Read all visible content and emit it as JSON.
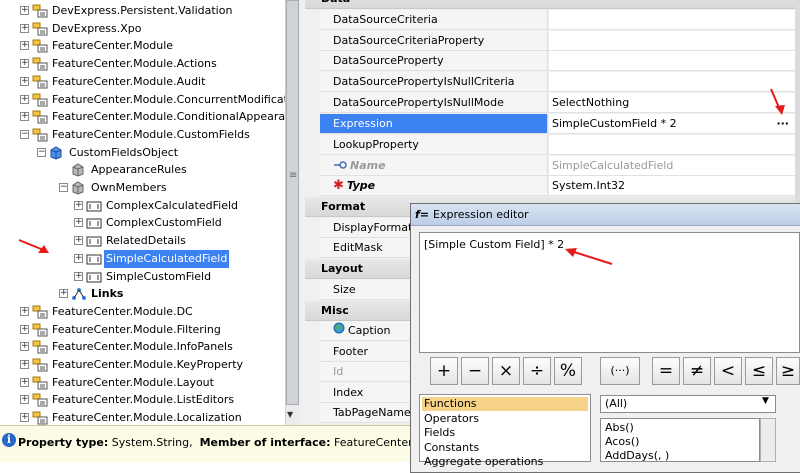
{
  "tree": {
    "items": [
      {
        "label": "DevExpress.Persistent.Validation",
        "level": 0,
        "icon": "namespace-icon",
        "expander": "+"
      },
      {
        "label": "DevExpress.Xpo",
        "level": 0,
        "icon": "namespace-icon",
        "expander": "+"
      },
      {
        "label": "FeatureCenter.Module",
        "level": 0,
        "icon": "namespace-icon",
        "expander": "+"
      },
      {
        "label": "FeatureCenter.Module.Actions",
        "level": 0,
        "icon": "namespace-icon",
        "expander": "+"
      },
      {
        "label": "FeatureCenter.Module.Audit",
        "level": 0,
        "icon": "namespace-icon",
        "expander": "+"
      },
      {
        "label": "FeatureCenter.Module.ConcurrentModifications",
        "level": 0,
        "icon": "namespace-icon",
        "expander": "+"
      },
      {
        "label": "FeatureCenter.Module.ConditionalAppearance",
        "level": 0,
        "icon": "namespace-icon",
        "expander": "+"
      },
      {
        "label": "FeatureCenter.Module.CustomFields",
        "level": 0,
        "icon": "namespace-icon",
        "expander": "-"
      },
      {
        "label": "CustomFieldsObject",
        "level": 1,
        "icon": "class-cube-icon",
        "expander": "-"
      },
      {
        "label": "AppearanceRules",
        "level": 2,
        "icon": "gray-cube-icon",
        "expander": ""
      },
      {
        "label": "OwnMembers",
        "level": 2,
        "icon": "gray-cube-icon",
        "expander": "-"
      },
      {
        "label": "ComplexCalculatedField",
        "level": 3,
        "icon": "member-field-icon",
        "expander": "+"
      },
      {
        "label": "ComplexCustomField",
        "level": 3,
        "icon": "member-field-icon",
        "expander": "+"
      },
      {
        "label": "RelatedDetails",
        "level": 3,
        "icon": "member-field-icon",
        "expander": "+"
      },
      {
        "label": "SimpleCalculatedField",
        "level": 3,
        "icon": "member-field-icon",
        "expander": "+",
        "selected": true
      },
      {
        "label": "SimpleCustomField",
        "level": 3,
        "icon": "member-field-icon",
        "expander": "+"
      },
      {
        "label": "Links",
        "level": 2,
        "icon": "links-icon",
        "expander": "+",
        "bold": true
      },
      {
        "label": "FeatureCenter.Module.DC",
        "level": 0,
        "icon": "namespace-icon",
        "expander": "+"
      },
      {
        "label": "FeatureCenter.Module.Filtering",
        "level": 0,
        "icon": "namespace-icon",
        "expander": "+"
      },
      {
        "label": "FeatureCenter.Module.InfoPanels",
        "level": 0,
        "icon": "namespace-icon",
        "expander": "+"
      },
      {
        "label": "FeatureCenter.Module.KeyProperty",
        "level": 0,
        "icon": "namespace-icon",
        "expander": "+"
      },
      {
        "label": "FeatureCenter.Module.Layout",
        "level": 0,
        "icon": "namespace-icon",
        "expander": "+"
      },
      {
        "label": "FeatureCenter.Module.ListEditors",
        "level": 0,
        "icon": "namespace-icon",
        "expander": "+"
      },
      {
        "label": "FeatureCenter.Module.Localization",
        "level": 0,
        "icon": "namespace-icon",
        "expander": "+"
      }
    ]
  },
  "grid": {
    "sections": [
      {
        "title": "Data",
        "collapse": "^"
      },
      {
        "title": "Format"
      },
      {
        "title": "Layout"
      },
      {
        "title": "Misc"
      }
    ],
    "data_rows": [
      {
        "name": "DataSourceCriteria",
        "value": ""
      },
      {
        "name": "DataSourceCriteriaProperty",
        "value": ""
      },
      {
        "name": "DataSourceProperty",
        "value": ""
      },
      {
        "name": "DataSourcePropertyIsNullCriteria",
        "value": ""
      },
      {
        "name": "DataSourcePropertyIsNullMode",
        "value": "SelectNothing"
      },
      {
        "name": "Expression",
        "value": "SimpleCustomField * 2",
        "ellipsis": "···"
      },
      {
        "name": "LookupProperty",
        "value": ""
      },
      {
        "name": "Name",
        "value": "SimpleCalculatedField"
      },
      {
        "name": "Type",
        "value": "System.Int32"
      }
    ],
    "format_rows": [
      {
        "name": "DisplayFormat",
        "value": ""
      },
      {
        "name": "EditMask",
        "value": ""
      }
    ],
    "layout_rows": [
      {
        "name": "Size",
        "value": ""
      }
    ],
    "misc_rows": [
      {
        "name": "Caption",
        "value": ""
      },
      {
        "name": "Footer",
        "value": ""
      },
      {
        "name": "Id",
        "value": ""
      },
      {
        "name": "Index",
        "value": ""
      },
      {
        "name": "TabPageName",
        "value": ""
      }
    ]
  },
  "dialog": {
    "fx": "f=",
    "title": "Expression editor",
    "expression": "[Simple Custom Field] * 2",
    "operators": [
      "+",
      "−",
      "×",
      "÷",
      "%",
      "(···)",
      "=",
      "≠",
      "<",
      "≤",
      "≥"
    ],
    "categories": [
      "Functions",
      "Operators",
      "Fields",
      "Constants",
      "Aggregate operations"
    ],
    "filter_value": "(All)",
    "functions": [
      "Abs()",
      "Acos()",
      "AddDays(, )"
    ]
  },
  "status": {
    "label1": "Property type:",
    "value1": "System.String,",
    "label2": "Member of interface:",
    "value2": "FeatureCenter.Module.I"
  },
  "colors": {
    "selection": "#3d82f3",
    "annotation_arrow": "#e51b1b",
    "category_selected": "#f7d38a"
  }
}
